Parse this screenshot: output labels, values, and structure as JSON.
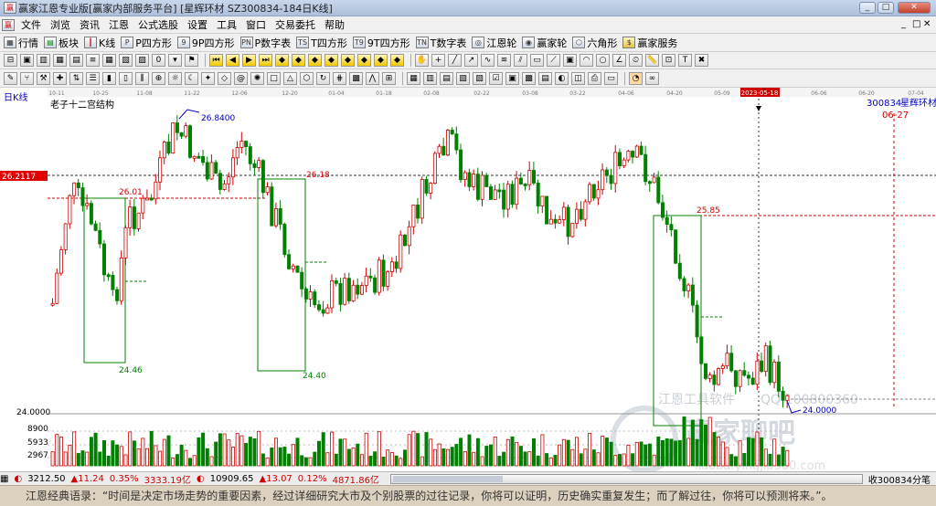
{
  "window": {
    "title": "赢家江恩专业版[赢家内部服务平台] [星辉环材  SZ300834-184日K线]",
    "minimize": "_",
    "maximize": "□",
    "close": "✕"
  },
  "menu": [
    "文件",
    "浏览",
    "资讯",
    "江恩",
    "公式选股",
    "设置",
    "工具",
    "窗口",
    "交易委托",
    "帮助"
  ],
  "mdi_controls": [
    "_",
    "□",
    "✕"
  ],
  "toolbar1": [
    {
      "label": "行情",
      "icon": "grid-icon"
    },
    {
      "label": "板块",
      "icon": "blocks-icon"
    },
    {
      "label": "K线",
      "icon": "kline-icon"
    },
    {
      "label": "P四方形",
      "icon": "square-icon"
    },
    {
      "label": "9P四方形",
      "icon": "square9-icon"
    },
    {
      "label": "P数字表",
      "icon": "pn-icon"
    },
    {
      "label": "T四方形",
      "icon": "ts-icon"
    },
    {
      "label": "9T四方形",
      "icon": "t9-icon"
    },
    {
      "label": "T数字表",
      "icon": "tn-icon"
    },
    {
      "label": "江恩轮",
      "icon": "gann-wheel-icon"
    },
    {
      "label": "赢家轮",
      "icon": "winner-wheel-icon"
    },
    {
      "label": "六角形",
      "icon": "hexagon-icon"
    },
    {
      "label": "赢家服务",
      "icon": "dollar-icon"
    }
  ],
  "toolbar2_zero": "0",
  "stock": {
    "code": "300834",
    "name": "星辉环材",
    "period_tag": "日K线",
    "structure_label": "老子十二宫结构",
    "date_flag": "06-27",
    "current_price_tag": "26.2117"
  },
  "chart_data": {
    "type": "candlestick",
    "x_ticks": [
      "10-11",
      "10-25",
      "11-08",
      "11-22",
      "12-06",
      "12-20",
      "01-04",
      "01-18",
      "02-08",
      "02-22",
      "03-08",
      "03-22",
      "04-06",
      "04-20",
      "05-09",
      "2023-05-18",
      "06-06",
      "06-20",
      "07-04"
    ],
    "highlight_date": "2023-05-18",
    "annotations": [
      "26.8400",
      "26.18",
      "26.01",
      "25.85",
      "24.46",
      "24.40",
      "24.0000"
    ],
    "left_level": "24.0000",
    "volume_ticks": [
      "8900",
      "5933",
      "2967"
    ],
    "volume_unit": "收300834分笔"
  },
  "statusbar": {
    "index1_value": "3212.50",
    "index1_change": "▲11.24",
    "index1_pct": "0.35%",
    "index1_amount": "3333.19亿",
    "index2_value": "10909.65",
    "index2_change": "▲13.07",
    "index2_pct": "0.12%",
    "index2_amount": "4871.86亿",
    "right_text": "收300834分笔"
  },
  "watermark": {
    "line1": "江恩工具软件",
    "line2": "QQ:100800360",
    "line3": "赢家聊吧",
    "line4": "liaoba.yingjia360.com"
  },
  "quote": "江恩经典语录：“时间是决定市场走势的重要因素，经过详细研究大市及个别股票的过往记录，你将可以证明，历史确实重复发生；而了解过往，你将可以预测将来。”。",
  "colors": {
    "up": "#d00000",
    "down": "#008000",
    "accent": "#d00000"
  }
}
